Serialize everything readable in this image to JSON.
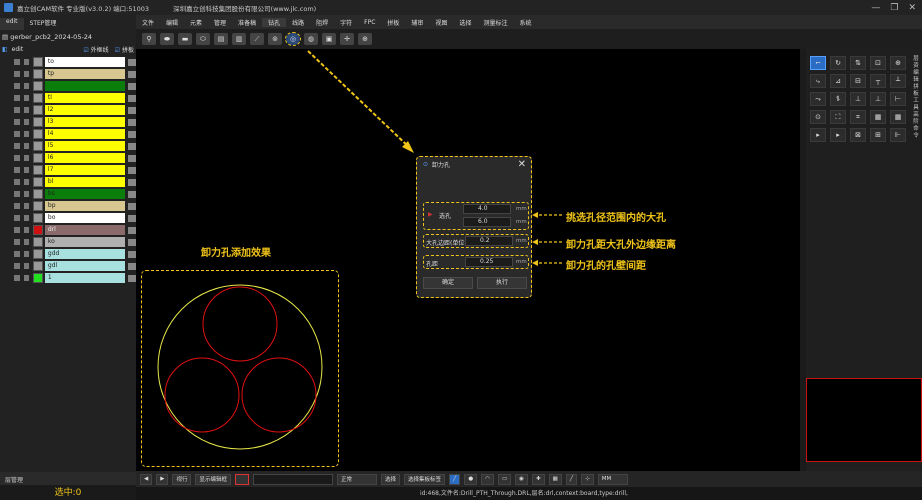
{
  "app": {
    "title": "嘉立创CAM软件 专业版(v3.0.2) 端口:51003",
    "company": "深圳嘉立创科技集团股份有限公司(www.jlc.com)",
    "window_controls": [
      "—",
      "❐",
      "✕"
    ]
  },
  "menu": [
    "文件",
    "编辑",
    "元素",
    "管理",
    "准备稿",
    "钻孔",
    "线路",
    "阻焊",
    "字符",
    "FPC",
    "拼板",
    "辅审",
    "视图",
    "选择",
    "测量标注",
    "系统"
  ],
  "menu_active": "钻孔",
  "toolbar_icons": [
    "tool-1-icon",
    "tool-2-icon",
    "tool-3-icon",
    "tool-4-icon",
    "tool-5-icon",
    "tool-6-icon",
    "tool-7-icon",
    "tool-8-icon",
    "relief-hole-icon",
    "tool-10-icon",
    "tool-11-icon",
    "tool-12-icon",
    "tool-13-icon"
  ],
  "left_panel": {
    "tabs": [
      "edit",
      "STEP管理"
    ],
    "project": "gerber_pcb2_2024-05-24",
    "layer_header": "edit",
    "checkbox_outline": "外框线",
    "checkbox_panel": "拼板",
    "layers": [
      {
        "name": "to",
        "color": "#ffffff"
      },
      {
        "name": "tp",
        "color": "#d8c690"
      },
      {
        "name": "",
        "color": "#0a7d0a"
      },
      {
        "name": "tl",
        "color": "#ffff00"
      },
      {
        "name": "l2",
        "color": "#ffff00"
      },
      {
        "name": "l3",
        "color": "#ffff00"
      },
      {
        "name": "l4",
        "color": "#ffff00"
      },
      {
        "name": "l5",
        "color": "#ffff00"
      },
      {
        "name": "l6",
        "color": "#ffff00"
      },
      {
        "name": "l7",
        "color": "#ffff00"
      },
      {
        "name": "bl",
        "color": "#ffff00"
      },
      {
        "name": "bs",
        "color": "#0a7d0a"
      },
      {
        "name": "bp",
        "color": "#d8c690"
      },
      {
        "name": "bo",
        "color": "#ffffff"
      },
      {
        "name": "drl",
        "color": "#8a6a6a"
      },
      {
        "name": "ko",
        "color": "#b0b0b0"
      },
      {
        "name": "gdd",
        "color": "#a8e0e0"
      },
      {
        "name": "gdl",
        "color": "#a8e0e0"
      },
      {
        "name": "1",
        "color": "#a8e0e0"
      }
    ],
    "layer_manager": "层管理",
    "selected_count": "选中:0"
  },
  "dialog": {
    "title": "卸力孔",
    "select_hole_label": "选孔",
    "min_value": "4.0",
    "max_value": "6.0",
    "unit": "mm",
    "distance_label": "大孔边距(单位)",
    "distance_value": "0.2",
    "spacing_label": "孔距",
    "spacing_value": "0.25",
    "confirm": "确定",
    "execute": "执行"
  },
  "annotations": {
    "effect": "卸力孔添加效果",
    "pick_hole": "挑选孔径范围内的大孔",
    "edge_distance": "卸力孔距大孔外边缘距离",
    "wall_spacing": "卸力孔的孔壁间距"
  },
  "bottom_bar": {
    "items": [
      "◀",
      "▶",
      "视行",
      "显示编辑框",
      "选择",
      "确定",
      "选择集板标签",
      "MM"
    ],
    "unit": "MM",
    "mode_select": "正常"
  },
  "status": "id:468,文件名:Drill_PTH_Through.DRL,层名:drl,context:board,type:drill,",
  "right_tabs": [
    "层",
    "资",
    "编",
    "辑",
    "拼",
    "板",
    "工",
    "具",
    "高",
    "阶",
    "命",
    "令"
  ],
  "colors": {
    "accent": "#f0c419",
    "selection": "#2b6cc4",
    "circle_outer": "#e8e84a",
    "circle_inner": "#e01010"
  }
}
